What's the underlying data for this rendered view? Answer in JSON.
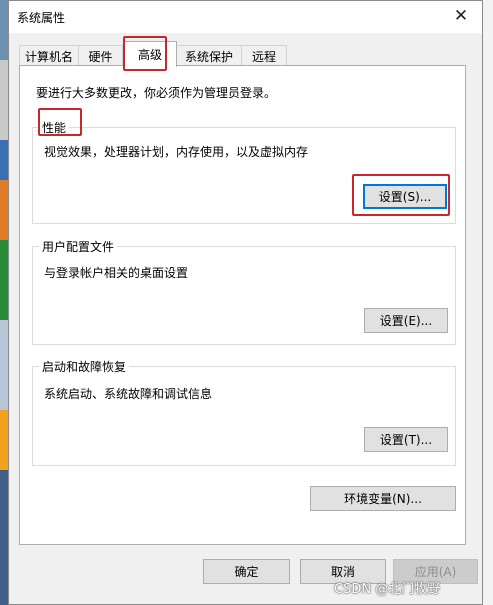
{
  "window": {
    "title": "系统属性"
  },
  "tabs": [
    {
      "label": "计算机名"
    },
    {
      "label": "硬件"
    },
    {
      "label": "高级",
      "active": true
    },
    {
      "label": "系统保护"
    },
    {
      "label": "远程"
    }
  ],
  "notice": "要进行大多数更改，你必须作为管理员登录。",
  "performance": {
    "title": "性能",
    "description": "视觉效果，处理器计划，内存使用，以及虚拟内存",
    "button": "设置(S)..."
  },
  "user_profiles": {
    "title": "用户配置文件",
    "description": "与登录帐户相关的桌面设置",
    "button": "设置(E)..."
  },
  "startup_recovery": {
    "title": "启动和故障恢复",
    "description": "系统启动、系统故障和调试信息",
    "button": "设置(T)..."
  },
  "env_button": "环境变量(N)...",
  "footer": {
    "ok": "确定",
    "cancel": "取消",
    "apply": "应用(A)"
  },
  "watermark": "CSDN @北门牧野",
  "colors": {
    "highlight_box": "#c8282d",
    "default_button_border": "#0078d7"
  }
}
